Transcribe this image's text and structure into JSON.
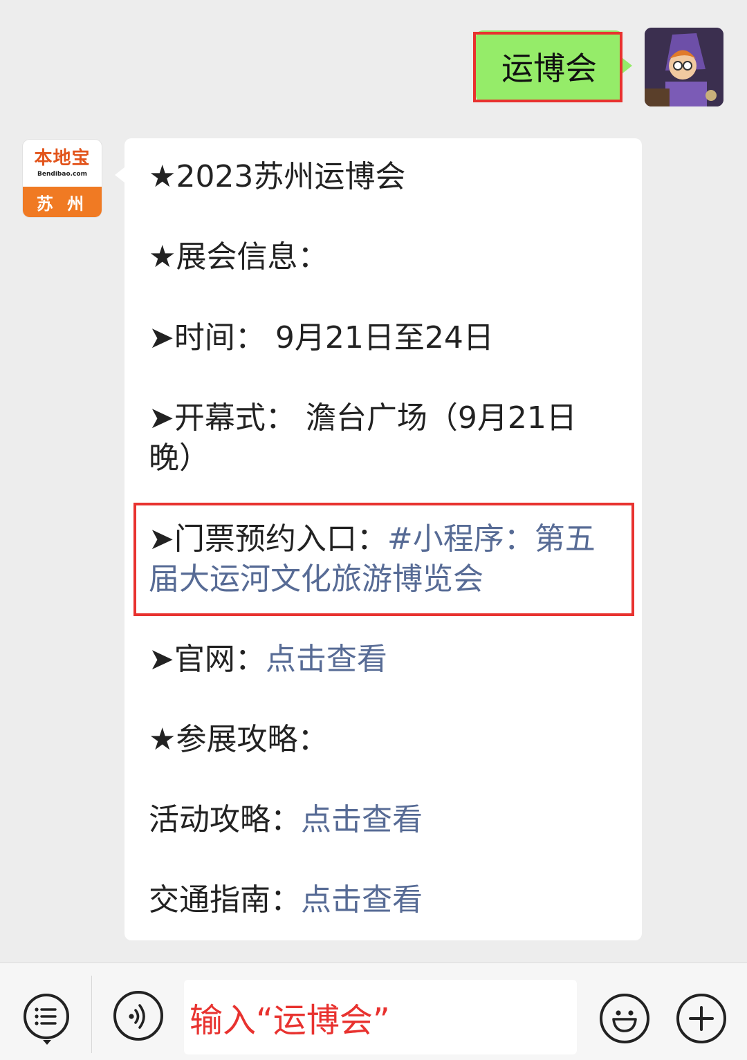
{
  "outgoing_message": {
    "text": "运博会"
  },
  "bot_avatar": {
    "brand": "本地宝",
    "domain": "Bendibao.com",
    "city": "苏 州"
  },
  "message": {
    "title": "★2023苏州运博会",
    "section_info": "★展会信息：",
    "time": "➤时间： 9月21日至24日",
    "opening_prefix": "➤开幕式： 澹台广场（9月21日晚）",
    "ticket_prefix": "➤门票预约入口：",
    "ticket_link": "#小程序：第五届大运河文化旅游博览会",
    "website_prefix": "➤官网：",
    "website_link": "点击查看",
    "section_guide": "★参展攻略：",
    "activity_prefix": "活动攻略：",
    "activity_link": "点击查看",
    "traffic_prefix": "交通指南：",
    "traffic_link": "点击查看"
  },
  "input_bar": {
    "placeholder": "输入“运博会”",
    "icons": [
      "menu-list-icon",
      "voice-icon",
      "emoji-icon",
      "add-icon"
    ]
  },
  "colors": {
    "accent_green": "#95ec69",
    "link_blue": "#576b95",
    "highlight_red": "#e8322f"
  }
}
